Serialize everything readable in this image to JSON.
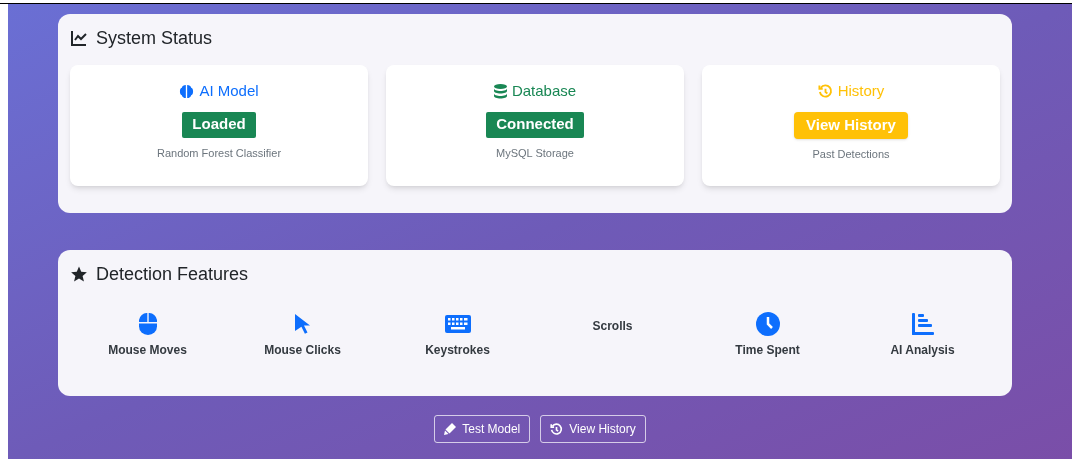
{
  "system_status": {
    "title": "System Status",
    "cards": [
      {
        "title": "AI Model",
        "color": "#0d6efd",
        "badge": {
          "text": "Loaded",
          "color": "#198754"
        },
        "caption": "Random Forest Classifier",
        "kind": "badge"
      },
      {
        "title": "Database",
        "color": "#198754",
        "badge": {
          "text": "Connected",
          "color": "#198754"
        },
        "caption": "MySQL Storage",
        "kind": "badge"
      },
      {
        "title": "History",
        "color": "#ffc107",
        "badge": {
          "text": "View History",
          "color": "#ffc107"
        },
        "caption": "Past Detections",
        "kind": "button"
      }
    ]
  },
  "detection_features": {
    "title": "Detection Features",
    "items": [
      {
        "label": "Mouse Moves",
        "kind": "icon"
      },
      {
        "label": "Mouse Clicks",
        "kind": "icon"
      },
      {
        "label": "Keystrokes",
        "kind": "icon"
      },
      {
        "label": "Scrolls",
        "kind": "plain"
      },
      {
        "label": "Time Spent",
        "kind": "icon"
      },
      {
        "label": "AI Analysis",
        "kind": "icon"
      }
    ]
  },
  "actions": [
    "Test Model",
    "View History"
  ]
}
